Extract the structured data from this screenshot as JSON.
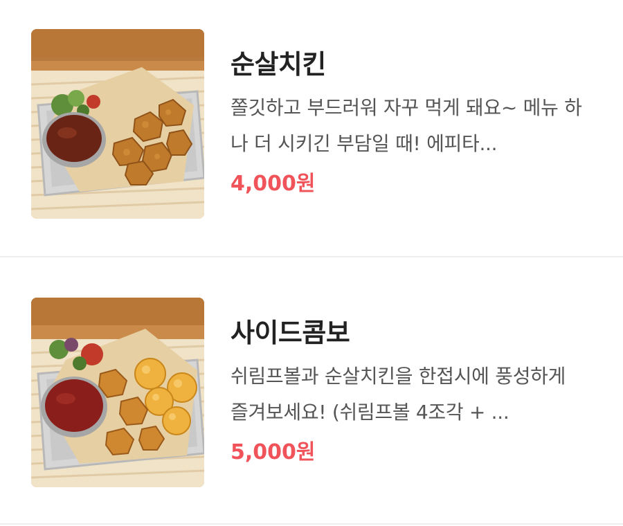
{
  "menu": {
    "items": [
      {
        "name": "순살치킨",
        "description": "쫄깃하고 부드러워 자꾸 먹게 돼요~ 메뉴 하나 더 시키긴 부담일 때! 에피타...",
        "price": "4,000원",
        "image_icon": "boneless-chicken-photo"
      },
      {
        "name": "사이드콤보",
        "description": "쉬림프볼과 순살치킨을 한접시에 풍성하게 즐겨보세요! (쉬림프볼 4조각 + ...",
        "price": "5,000원",
        "image_icon": "side-combo-photo"
      }
    ]
  },
  "colors": {
    "price": "#f0545a",
    "title": "#222222",
    "description": "#555555",
    "divider": "#eeeeee"
  }
}
